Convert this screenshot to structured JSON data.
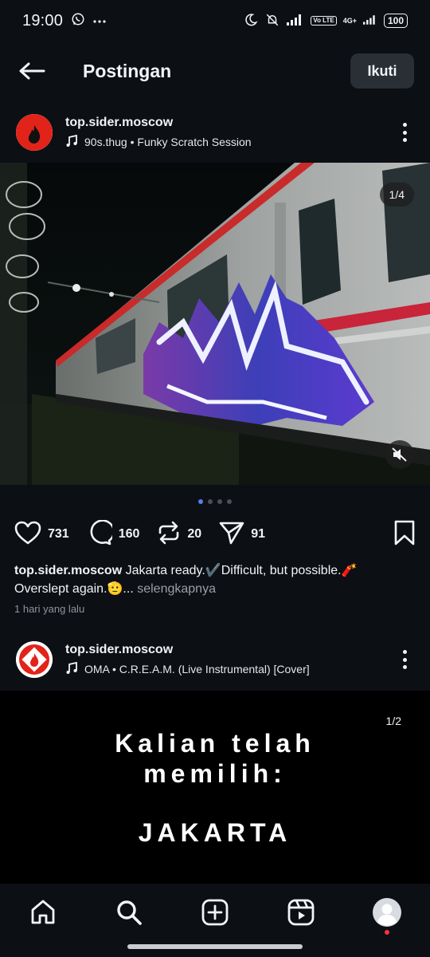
{
  "status_bar": {
    "time": "19:00",
    "network": "4G+",
    "volte": "Vo LTE",
    "battery": "100"
  },
  "header": {
    "title": "Postingan",
    "follow_label": "Ikuti"
  },
  "post1": {
    "username": "top.sider.moscow",
    "music": "90s.thug • Funky Scratch Session",
    "counter": "1/4",
    "likes": "731",
    "comments": "160",
    "reposts": "20",
    "shares": "91",
    "caption_user": "top.sider.moscow",
    "caption_text": "Jakarta ready.✔️Difficult, but possible.🧨 Overslept again.🫡...",
    "more_label": "selengkapnya",
    "time_ago": "1 hari yang lalu"
  },
  "post2": {
    "username": "top.sider.moscow",
    "music": "OMA • C.R.E.A.M. (Live Instrumental) [Cover]",
    "counter": "1/2",
    "line1": "Kalian telah",
    "line2": "memilih:",
    "line3": "JAKARTA"
  },
  "colors": {
    "background": "#0c0f14",
    "accent_dot": "#5b7cf0",
    "notification": "#ff3040",
    "avatar_red": "#e2231a"
  }
}
